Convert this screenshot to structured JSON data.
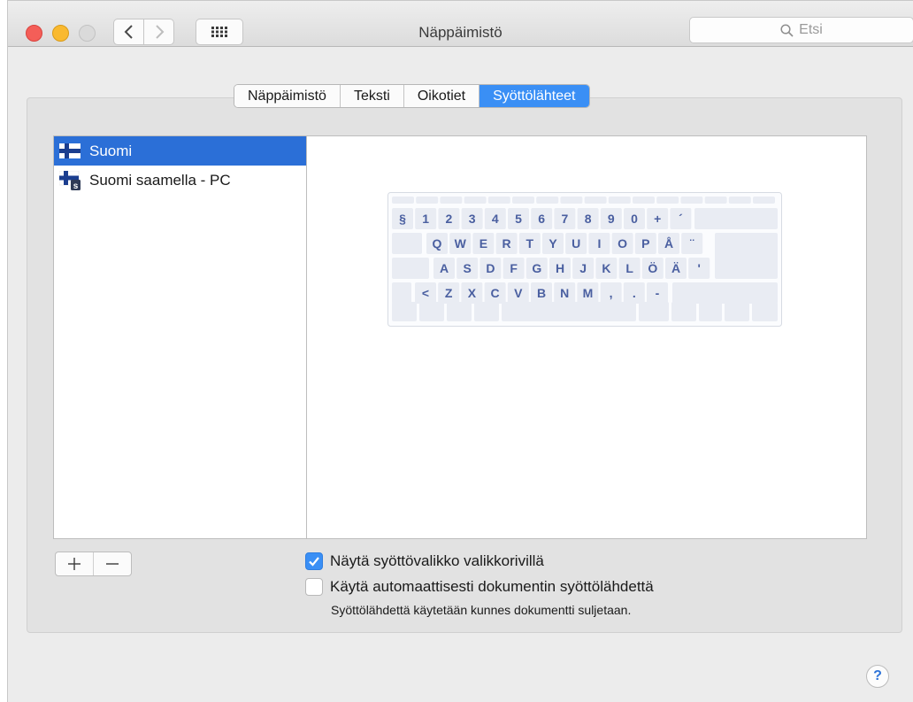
{
  "window": {
    "title": "Näppäimistö"
  },
  "search": {
    "placeholder": "Etsi"
  },
  "tabs": [
    {
      "label": "Näppäimistö"
    },
    {
      "label": "Teksti"
    },
    {
      "label": "Oikotiet"
    },
    {
      "label": "Syöttölähteet",
      "active": true
    }
  ],
  "input_sources": [
    {
      "label": "Suomi",
      "icon": "finland-flag-icon",
      "selected": true
    },
    {
      "label": "Suomi saamella - PC",
      "icon": "finland-saami-flag-icon",
      "selected": false
    }
  ],
  "keyboard_rows": [
    [
      "§",
      "1",
      "2",
      "3",
      "4",
      "5",
      "6",
      "7",
      "8",
      "9",
      "0",
      "+",
      "´"
    ],
    [
      "Q",
      "W",
      "E",
      "R",
      "T",
      "Y",
      "U",
      "I",
      "O",
      "P",
      "Å",
      "¨"
    ],
    [
      "A",
      "S",
      "D",
      "F",
      "G",
      "H",
      "J",
      "K",
      "L",
      "Ö",
      "Ä",
      "'"
    ],
    [
      "<",
      "Z",
      "X",
      "C",
      "V",
      "B",
      "N",
      "M",
      ",",
      ".",
      "-"
    ]
  ],
  "options": [
    {
      "label": "Näytä syöttövalikko valikkorivillä",
      "checked": true
    },
    {
      "label": "Käytä automaattisesti dokumentin syöttölähdettä",
      "checked": false
    }
  ],
  "note": "Syöttölähdettä käytetään kunnes dokumentti suljetaan.",
  "help": {
    "label": "?"
  },
  "colors": {
    "accent": "#3a8ff5",
    "selection": "#2b6fd7",
    "key_label": "#4a5fa0"
  }
}
